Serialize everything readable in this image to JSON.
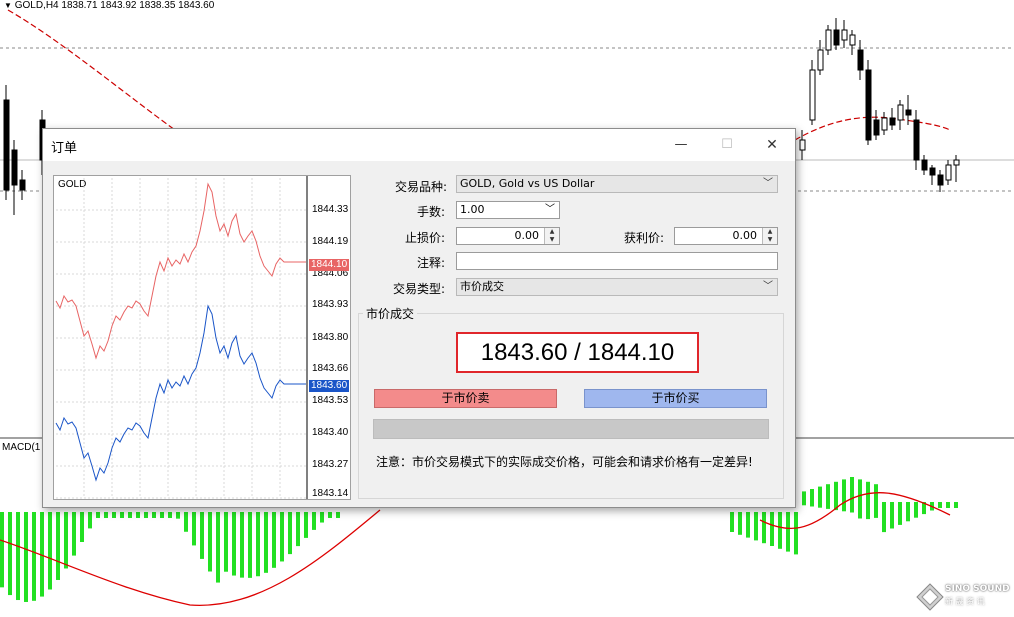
{
  "chart": {
    "title": "GOLD,H4  1838.71 1843.92 1838.35 1843.60",
    "macd_label": "MACD(1"
  },
  "dialog": {
    "title": "订单",
    "minimize": "—",
    "maximize": "☐",
    "close": "✕",
    "fields": {
      "symbol_label": "交易品种:",
      "symbol_value": "GOLD, Gold vs US Dollar",
      "volume_label": "手数:",
      "volume_value": "1.00",
      "stop_loss_label": "止损价:",
      "stop_loss_value": "0.00",
      "take_profit_label": "获利价:",
      "take_profit_value": "0.00",
      "comment_label": "注释:",
      "comment_value": "",
      "type_label": "交易类型:",
      "type_value": "市价成交"
    },
    "market_group": {
      "title": "市价成交",
      "price_display": "1843.60 / 1844.10",
      "sell_button": "于市价卖",
      "buy_button": "于市价买",
      "notice": "注意：市价交易模式下的实际成交价格，可能会和请求价格有一定差异!"
    },
    "tick_chart": {
      "symbol": "GOLD",
      "y_labels": [
        "1844.33",
        "1844.19",
        "1844.06",
        "1843.93",
        "1843.80",
        "1843.66",
        "1843.53",
        "1843.40",
        "1843.27",
        "1843.14"
      ],
      "ask_tag": "1844.10",
      "bid_tag": "1843.60",
      "ask_color": "#e86464",
      "bid_color": "#1a55c8"
    }
  },
  "watermark": {
    "line1": "SINO SOUND",
    "line2": "新 晟 资 讯"
  }
}
